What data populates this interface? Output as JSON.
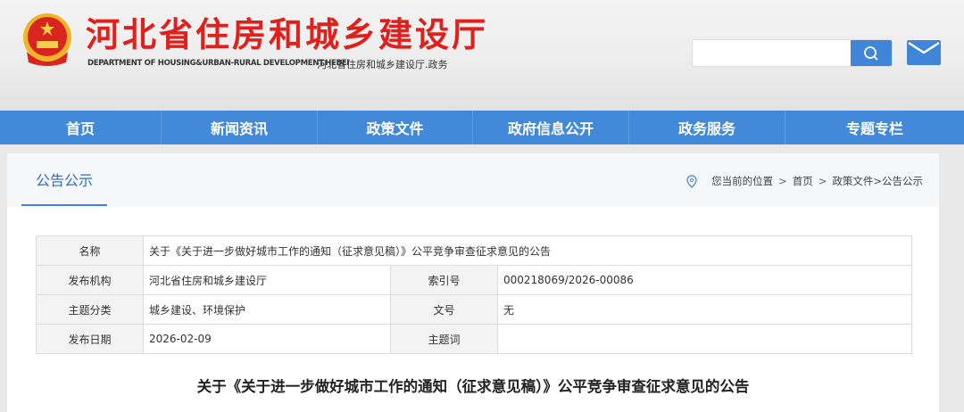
{
  "header": {
    "title": "河北省住房和城乡建设厅",
    "subtitle_en": "DEPARTMENT OF HOUSING&URBAN-RURAL DEVELOPMENT.HEBEI",
    "subtitle_cn": "河北省住房和城乡建设厅.政务",
    "search_placeholder": ""
  },
  "nav": [
    "首页",
    "新闻资讯",
    "政策文件",
    "政府信息公开",
    "政务服务",
    "专题专栏"
  ],
  "tab": "公告公示",
  "breadcrumb": {
    "prefix": "您当前的位置",
    "items": [
      "首页",
      "政策文件>公告公示"
    ]
  },
  "info": {
    "name_label": "名称",
    "name": "关于《关于进一步做好城市工作的通知（征求意见稿）》公平竞争审查征求意见的公告",
    "org_label": "发布机构",
    "org": "河北省住房和城乡建设厅",
    "index_label": "索引号",
    "index": "000218069/2026-00086",
    "cat_label": "主题分类",
    "cat": "城乡建设、环境保护",
    "docno_label": "文号",
    "docno": "无",
    "date_label": "发布日期",
    "date": "2026-02-09",
    "kw_label": "主题词",
    "kw": ""
  },
  "doc_title": "关于《关于进一步做好城市工作的通知（征求意见稿）》公平竞争审查征求意见的公告",
  "colors": {
    "brand_red": "#e0201c",
    "accent_blue": "#428ad9"
  }
}
